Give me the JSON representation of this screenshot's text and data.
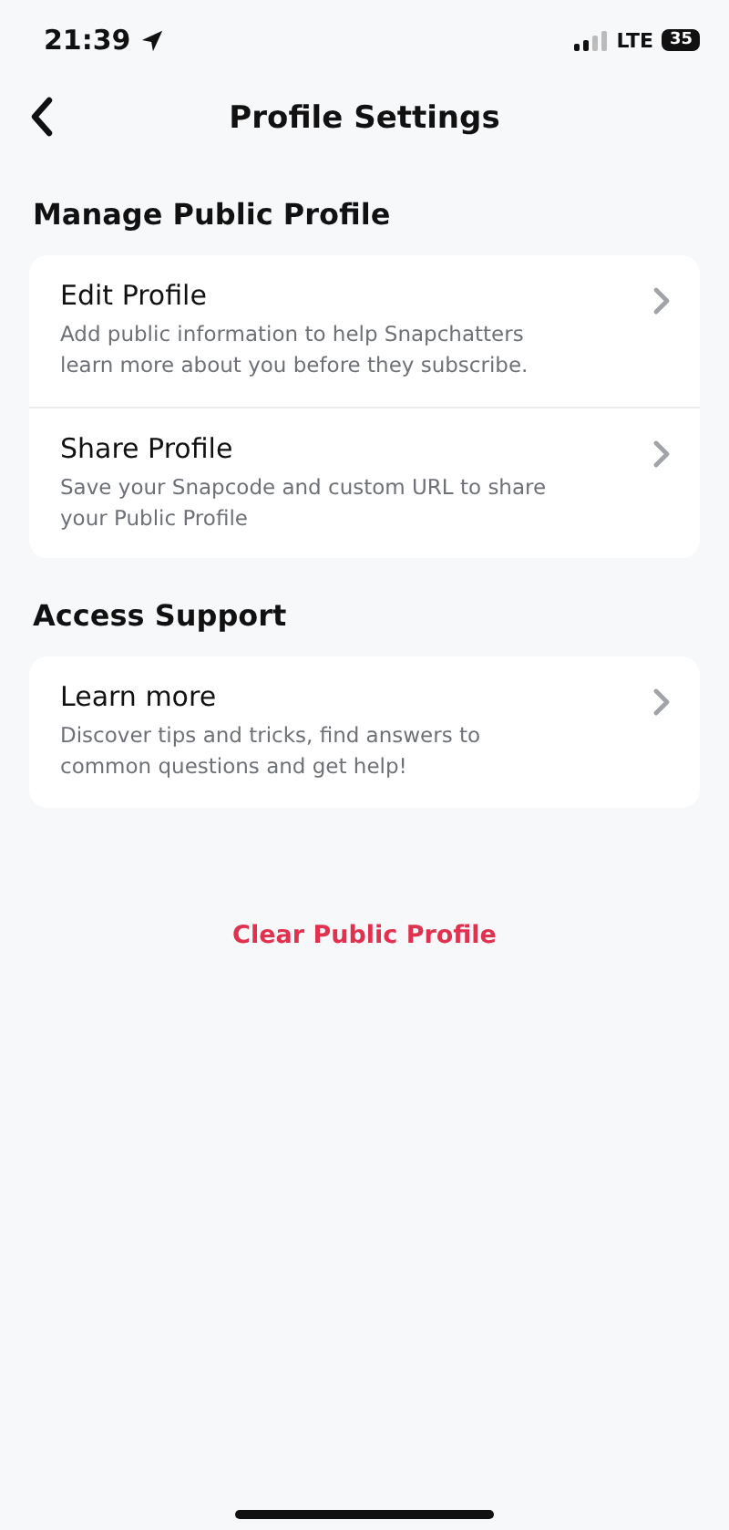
{
  "status_bar": {
    "time": "21:39",
    "network": "LTE",
    "battery": "35"
  },
  "header": {
    "title": "Profile Settings"
  },
  "sections": [
    {
      "title": "Manage Public Profile",
      "items": [
        {
          "title": "Edit Profile",
          "description": "Add public information to help Snapchatters learn more about you before they subscribe."
        },
        {
          "title": "Share Profile",
          "description": "Save your Snapcode and custom URL to share your Public Profile"
        }
      ]
    },
    {
      "title": "Access Support",
      "items": [
        {
          "title": "Learn more",
          "description": "Discover tips and tricks, find answers to common questions and get help!"
        }
      ]
    }
  ],
  "clear_link": "Clear Public Profile"
}
